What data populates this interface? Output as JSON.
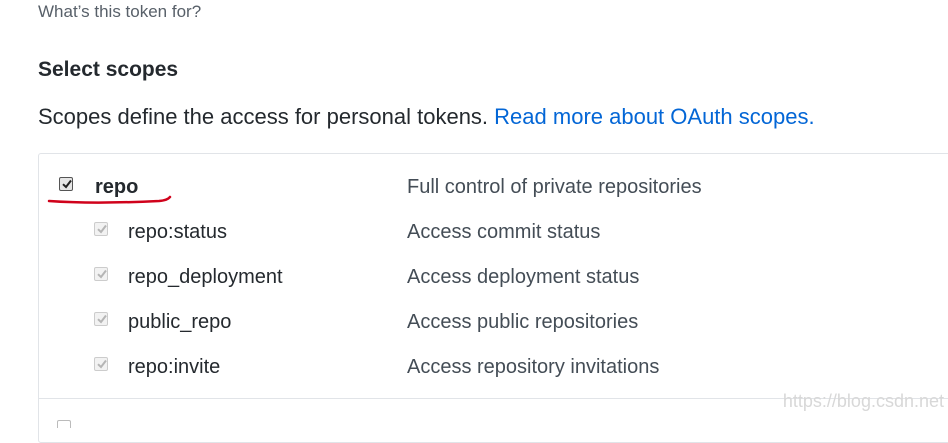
{
  "form": {
    "token_note_hint": "What’s this token for?"
  },
  "scopes": {
    "title": "Select scopes",
    "description": "Scopes define the access for personal tokens.",
    "read_more_link": "Read more about OAuth scopes.",
    "items": [
      {
        "name": "repo",
        "description": "Full control of private repositories",
        "checked": true,
        "level": "parent"
      },
      {
        "name": "repo:status",
        "description": "Access commit status",
        "checked": true,
        "level": "child"
      },
      {
        "name": "repo_deployment",
        "description": "Access deployment status",
        "checked": true,
        "level": "child"
      },
      {
        "name": "public_repo",
        "description": "Access public repositories",
        "checked": true,
        "level": "child"
      },
      {
        "name": "repo:invite",
        "description": "Access repository invitations",
        "checked": true,
        "level": "child"
      }
    ]
  },
  "annotation": {
    "underline_color": "#d0021b"
  },
  "watermark": {
    "text": "https://blog.csdn.net"
  },
  "colors": {
    "link": "#0366d6",
    "text": "#24292e",
    "muted": "#586069",
    "border": "#e1e4e8"
  }
}
